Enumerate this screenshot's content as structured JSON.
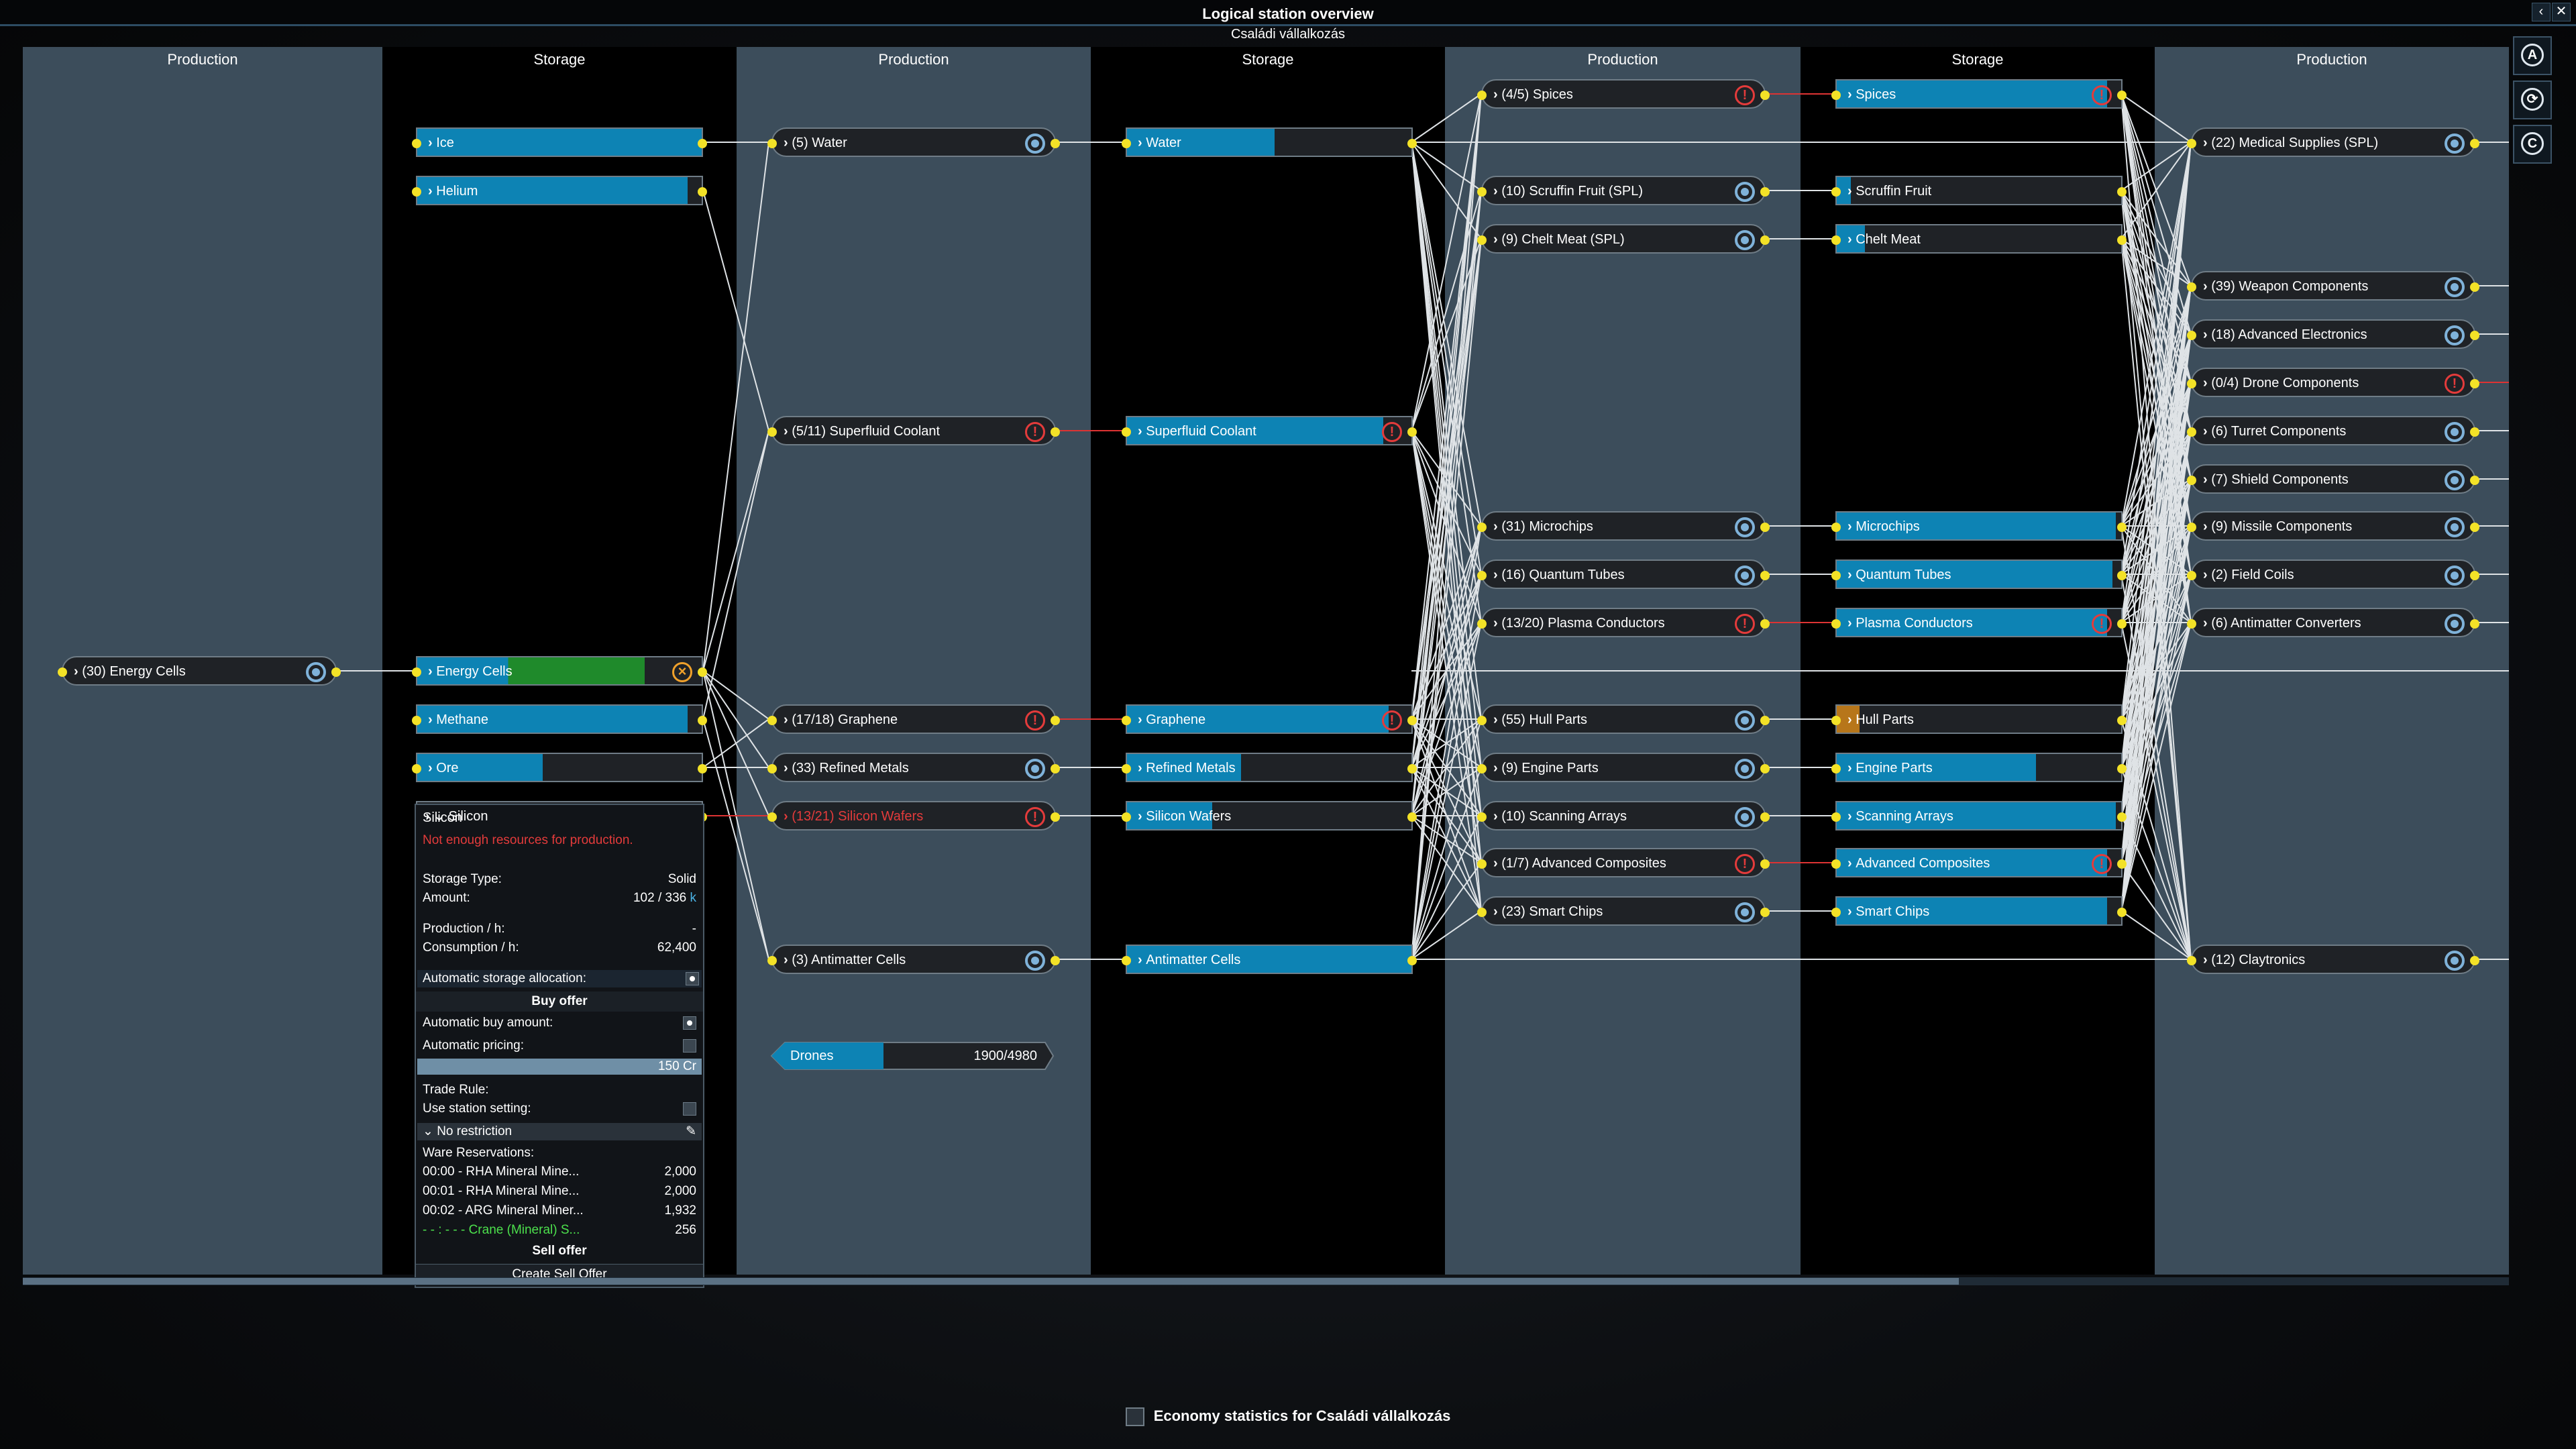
{
  "window": {
    "title": "Logical station overview",
    "subtitle": "Családi vállalkozás",
    "close": "✕",
    "back": "‹"
  },
  "columns": [
    "Production",
    "Storage",
    "Production",
    "Storage",
    "Production",
    "Storage",
    "Production"
  ],
  "side_buttons": [
    "A",
    "⟳",
    "C"
  ],
  "production": [
    {
      "label": "(30) Energy Cells",
      "status": "gear"
    },
    {
      "label": "(5) Water",
      "status": "gear"
    },
    {
      "label": "(5/11) Superfluid Coolant",
      "status": "warn"
    },
    {
      "label": "(17/18) Graphene",
      "status": "warn"
    },
    {
      "label": "(33) Refined Metals",
      "status": "gear"
    },
    {
      "label": "(13/21) Silicon Wafers",
      "status": "warn"
    },
    {
      "label": "(3) Antimatter Cells",
      "status": "gear"
    },
    {
      "label": "(4/5) Spices",
      "status": "warn"
    },
    {
      "label": "(10) Scruffin Fruit (SPL)",
      "status": "gear"
    },
    {
      "label": "(9) Chelt Meat (SPL)",
      "status": "gear"
    },
    {
      "label": "(31) Microchips",
      "status": "gear"
    },
    {
      "label": "(16) Quantum Tubes",
      "status": "gear"
    },
    {
      "label": "(13/20) Plasma Conductors",
      "status": "warn"
    },
    {
      "label": "(55) Hull Parts",
      "status": "gear"
    },
    {
      "label": "(9) Engine Parts",
      "status": "gear"
    },
    {
      "label": "(10) Scanning Arrays",
      "status": "gear"
    },
    {
      "label": "(1/7) Advanced Composites",
      "status": "warn"
    },
    {
      "label": "(23) Smart Chips",
      "status": "gear"
    },
    {
      "label": "(22) Medical Supplies (SPL)",
      "status": "gear"
    },
    {
      "label": "(39) Weapon Components",
      "status": "gear"
    },
    {
      "label": "(18) Advanced Electronics",
      "status": "gear"
    },
    {
      "label": "(0/4) Drone Components",
      "status": "warn"
    },
    {
      "label": "(6) Turret Components",
      "status": "gear"
    },
    {
      "label": "(7) Shield Components",
      "status": "gear"
    },
    {
      "label": "(9) Missile Components",
      "status": "gear"
    },
    {
      "label": "(2) Field Coils",
      "status": "gear"
    },
    {
      "label": "(6) Antimatter Converters",
      "status": "gear"
    },
    {
      "label": "(12) Claytronics",
      "status": "gear"
    }
  ],
  "storage": [
    {
      "label": "Ice",
      "fill": 1.0,
      "color": "#0d83b4",
      "status": ""
    },
    {
      "label": "Helium",
      "fill": 0.95,
      "color": "#0d83b4",
      "status": ""
    },
    {
      "label": "Energy Cells",
      "fill": 0.8,
      "color": "#1f8a2b",
      "status": "x"
    },
    {
      "label": "Methane",
      "fill": 0.95,
      "color": "#0d83b4",
      "status": ""
    },
    {
      "label": "Ore",
      "fill": 0.44,
      "color": "#0d83b4",
      "status": ""
    },
    {
      "label": "Water",
      "fill": 0.52,
      "color": "#0d83b4",
      "status": ""
    },
    {
      "label": "Superfluid Coolant",
      "fill": 0.9,
      "color": "#0d83b4",
      "status": "warn"
    },
    {
      "label": "Graphene",
      "fill": 0.92,
      "color": "#0d83b4",
      "status": "warn"
    },
    {
      "label": "Refined Metals",
      "fill": 0.4,
      "color": "#0d83b4",
      "status": ""
    },
    {
      "label": "Silicon Wafers",
      "fill": 0.3,
      "color": "#0d83b4",
      "status": ""
    },
    {
      "label": "Antimatter Cells",
      "fill": 1.0,
      "color": "#0d83b4",
      "status": ""
    },
    {
      "label": "Spices",
      "fill": 0.95,
      "color": "#0d83b4",
      "status": "warn"
    },
    {
      "label": "Scruffin Fruit",
      "fill": 0.05,
      "color": "#0d83b4",
      "status": ""
    },
    {
      "label": "Chelt Meat",
      "fill": 0.1,
      "color": "#0d83b4",
      "status": ""
    },
    {
      "label": "Microchips",
      "fill": 0.98,
      "color": "#0d83b4",
      "status": ""
    },
    {
      "label": "Quantum Tubes",
      "fill": 0.97,
      "color": "#0d83b4",
      "status": ""
    },
    {
      "label": "Plasma Conductors",
      "fill": 0.95,
      "color": "#0d83b4",
      "status": "warn"
    },
    {
      "label": "Hull Parts",
      "fill": 0.08,
      "color": "#b7761a",
      "status": ""
    },
    {
      "label": "Engine Parts",
      "fill": 0.7,
      "color": "#0d83b4",
      "status": ""
    },
    {
      "label": "Scanning Arrays",
      "fill": 0.98,
      "color": "#0d83b4",
      "status": ""
    },
    {
      "label": "Advanced Composites",
      "fill": 0.95,
      "color": "#0d83b4",
      "status": "warn"
    },
    {
      "label": "Smart Chips",
      "fill": 0.95,
      "color": "#0d83b4",
      "status": ""
    }
  ],
  "silicon_panel": {
    "label": "Silicon",
    "warning": "Not enough resources for production.",
    "storage_type_label": "Storage Type:",
    "storage_type": "Solid",
    "amount_label": "Amount:",
    "amount": "102 / 336",
    "amount_unit": "k",
    "production_label": "Production / h:",
    "production": "-",
    "consumption_label": "Consumption / h:",
    "consumption": "62,400",
    "auto_alloc": "Automatic storage allocation:",
    "buy_offer": "Buy offer",
    "auto_buy": "Automatic buy amount:",
    "auto_pricing": "Automatic pricing:",
    "price": "150 Cr",
    "trade_rule": "Trade Rule:",
    "use_station": "Use station setting:",
    "no_restriction": "No restriction",
    "reservations_label": "Ware Reservations:",
    "reservations": [
      {
        "name": "00:00 - RHA Mineral Mine...",
        "amount": "2,000",
        "highlight": false
      },
      {
        "name": "00:01 - RHA Mineral Mine...",
        "amount": "2,000",
        "highlight": false
      },
      {
        "name": "00:02 - ARG Mineral Miner...",
        "amount": "1,932",
        "highlight": false
      },
      {
        "name": "- - : - - - Crane (Mineral) S...",
        "amount": "256",
        "highlight": true
      }
    ],
    "sell_offer": "Sell offer",
    "create_sell_offer": "Create Sell Offer"
  },
  "drones": {
    "label": "Drones",
    "value": "1900/4980",
    "fill": 0.38
  },
  "footer": {
    "label": "Economy statistics for Családi vállalkozás"
  },
  "colors": {
    "prod_col": "#3c4d5b",
    "storage_col": "#000000",
    "accent": "#0d83b4",
    "port": "#f3e227",
    "warn": "#e43b3b"
  }
}
